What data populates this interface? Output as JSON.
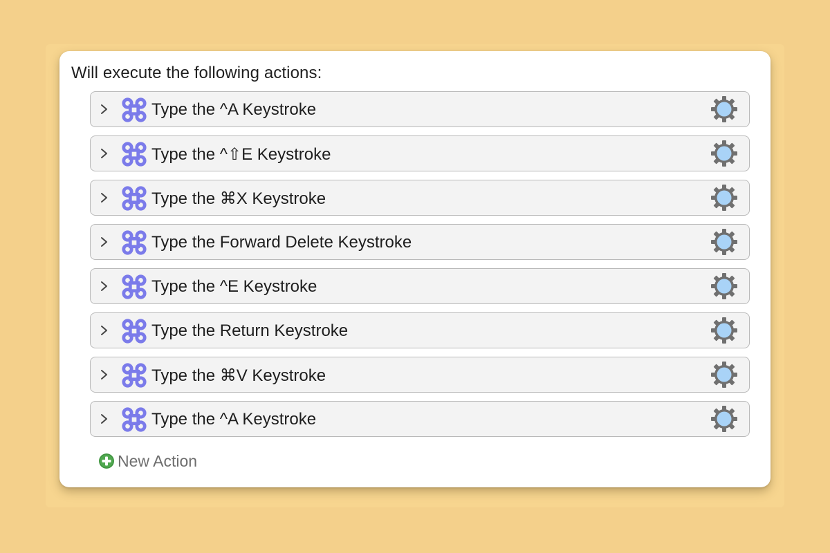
{
  "panel": {
    "title": "Will execute the following actions:"
  },
  "actions": [
    {
      "label": "Type the ^A Keystroke"
    },
    {
      "label": "Type the ^⇧E Keystroke"
    },
    {
      "label": "Type the ⌘X Keystroke"
    },
    {
      "label": "Type the Forward Delete Keystroke"
    },
    {
      "label": "Type the ^E Keystroke"
    },
    {
      "label": "Type the Return Keystroke"
    },
    {
      "label": "Type the ⌘V Keystroke"
    },
    {
      "label": "Type the ^A Keystroke"
    }
  ],
  "new_action": {
    "label": "New Action"
  },
  "icons": {
    "row_icon": "command-key-icon",
    "settings_icon": "gear-icon",
    "expand_icon": "chevron-right-icon",
    "add_icon": "plus-circle-icon"
  },
  "colors": {
    "background": "#f4d08b",
    "command_icon": "#7b7bea",
    "gear_body": "#707070",
    "gear_center": "#a9d3f7",
    "add_icon": "#4fa84f"
  }
}
